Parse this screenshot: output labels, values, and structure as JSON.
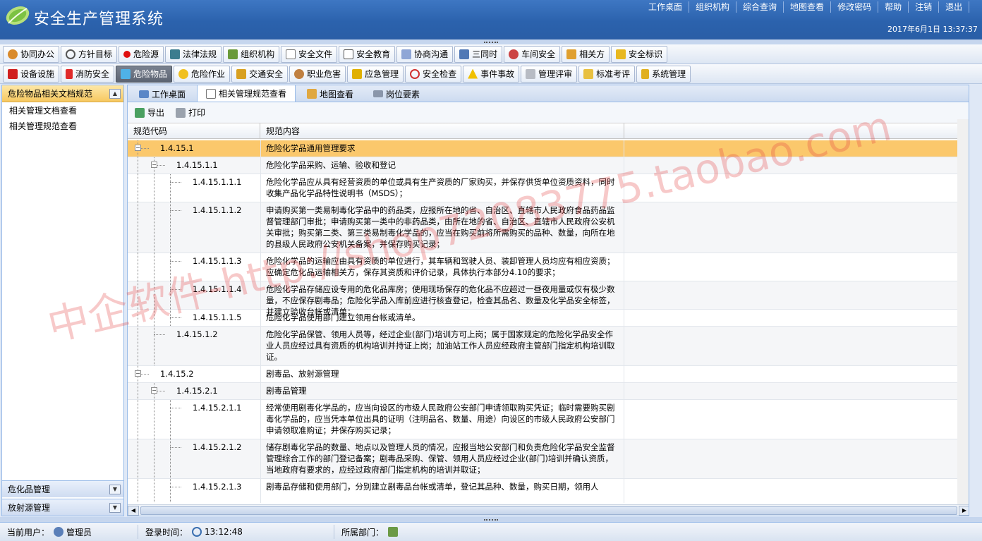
{
  "header": {
    "app_title": "安全生产管理系统",
    "nav": [
      "工作桌面",
      "组织机构",
      "综合查询",
      "地图查看",
      "修改密码",
      "帮助",
      "注销",
      "退出"
    ],
    "datetime": "2017年6月1日  13:37:37"
  },
  "toolbar_row1": [
    "协同办公",
    "方针目标",
    "危险源",
    "法律法规",
    "组织机构",
    "安全文件",
    "安全教育",
    "协商沟通",
    "三同时",
    "车间安全",
    "相关方",
    "安全标识"
  ],
  "toolbar_row2": [
    "设备设施",
    "消防安全",
    "危险物品",
    "危险作业",
    "交通安全",
    "职业危害",
    "应急管理",
    "安全检查",
    "事件事故",
    "管理评审",
    "标准考评",
    "系统管理"
  ],
  "active_module": "危险物品",
  "sidebar": {
    "title": "危险物品相关文档规范",
    "items": [
      "相关管理文档查看",
      "相关管理规范查看"
    ],
    "panels": [
      "危化品管理",
      "放射源管理"
    ]
  },
  "tabs": [
    "工作桌面",
    "相关管理规范查看",
    "地图查看",
    "岗位要素"
  ],
  "active_tab": "相关管理规范查看",
  "grid_actions": {
    "export": "导出",
    "print": "打印"
  },
  "columns": [
    "规范代码",
    "规范内容"
  ],
  "rows": [
    {
      "code": "1.4.15.1",
      "level": 0,
      "expand": "−",
      "content": "危险化学品通用管理要求"
    },
    {
      "code": "1.4.15.1.1",
      "level": 1,
      "expand": "−",
      "content": "危险化学品采购、运输、验收和登记"
    },
    {
      "code": "1.4.15.1.1.1",
      "level": 2,
      "content": "危险化学品应从具有经营资质的单位或具有生产资质的厂家购买，并保存供货单位资质资料，同时收集产品化学品特性说明书（MSDS）；"
    },
    {
      "code": "1.4.15.1.1.2",
      "level": 2,
      "content": "申请购买第一类易制毒化学品中的药品类，应报所在地的省、自治区、直辖市人民政府食品药品监督管理部门审批；申请购买第一类中的非药品类，由所在地的省、自治区、直辖市人民政府公安机关审批；购买第二类、第三类易制毒化学品的，应当在购买前将所需购买的品种、数量，向所在地的县级人民政府公安机关备案，并保存购买记录；"
    },
    {
      "code": "1.4.15.1.1.3",
      "level": 2,
      "content": "危险化学品的运输应由具有资质的单位进行，其车辆和驾驶人员、装卸管理人员均应有相应资质；应确定危化品运输相关方，保存其资质和评价记录，具体执行本部分4.10的要求；"
    },
    {
      "code": "1.4.15.1.1.4",
      "level": 2,
      "content": "危险化学品存储应设专用的危化品库房；使用现场保存的危化品不应超过一昼夜用量或仅有极少数量，不应保存剧毒品；危险化学品入库前应进行核查登记，检查其品名、数量及化学品安全标签，并建立验收台帐或清单；"
    },
    {
      "code": "1.4.15.1.1.5",
      "level": 2,
      "content": "危险化学品使用部门建立领用台帐或清单。"
    },
    {
      "code": "1.4.15.1.2",
      "level": 1,
      "content": "危险化学品保管、领用人员等，经过企业(部门)培训方可上岗；属于国家规定的危险化学品安全作业人员应经过具有资质的机构培训并持证上岗；加油站工作人员应经政府主管部门指定机构培训取证。"
    },
    {
      "code": "1.4.15.2",
      "level": 0,
      "expand": "−",
      "content": "剧毒品、放射源管理"
    },
    {
      "code": "1.4.15.2.1",
      "level": 1,
      "expand": "−",
      "content": "剧毒品管理"
    },
    {
      "code": "1.4.15.2.1.1",
      "level": 2,
      "content": "经常使用剧毒化学品的，应当向设区的市级人民政府公安部门申请领取购买凭证；临时需要购买剧毒化学品的，应当凭本单位出具的证明（注明品名、数量、用途）向设区的市级人民政府公安部门申请领取准购证；并保存购买记录；"
    },
    {
      "code": "1.4.15.2.1.2",
      "level": 2,
      "content": "储存剧毒化学品的数量、地点以及管理人员的情况，应报当地公安部门和负责危险化学品安全监督管理综合工作的部门登记备案；剧毒品采购、保管、领用人员应经过企业(部门)培训并确认资质，当地政府有要求的，应经过政府部门指定机构的培训并取证；"
    },
    {
      "code": "1.4.15.2.1.3",
      "level": 2,
      "content": "剧毒品存储和使用部门，分别建立剧毒品台帐或清单，登记其品种、数量，购买日期，领用人"
    }
  ],
  "status": {
    "user_label": "当前用户：",
    "user": "管理员",
    "login_label": "登录时间：",
    "login_time": "13:12:48",
    "dept_label": "所属部门："
  },
  "watermark": "中企软件-http://shop72083775.taobao.com",
  "colors": {
    "header": "#2b62ad",
    "selected_row": "#fbc86c",
    "sidebar_head": "#f7c860",
    "panel_border": "#99bbe8"
  }
}
